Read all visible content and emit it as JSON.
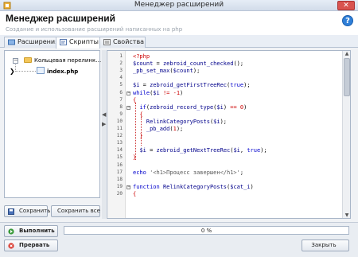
{
  "window": {
    "title": "Менеджер расширений",
    "close": "✕"
  },
  "header": {
    "title": "Менеджер расширений",
    "subtitle": "Создание и использование расширений написанных на php",
    "help": "?"
  },
  "tabs": [
    {
      "label": "Расширения"
    },
    {
      "label": "Скрипты"
    },
    {
      "label": "Свойства"
    }
  ],
  "tree": {
    "folder": "Кольцевая перелинк…",
    "file": "index.php"
  },
  "left_buttons": {
    "save": "Сохранить",
    "save_all": "Сохранить все"
  },
  "code_lines": [
    {
      "n": "1",
      "html": "<span class='ph'>&lt;?php</span>"
    },
    {
      "n": "2",
      "html": "<span class='var'>$count</span> = <span class='fn'>zebroid_count_checked</span>();"
    },
    {
      "n": "3",
      "html": "<span class='fn'>_pb_set_max</span>(<span class='var'>$count</span>);"
    },
    {
      "n": "4",
      "html": ""
    },
    {
      "n": "5",
      "html": "<span class='var'>$i</span> = <span class='fn'>zebroid_getFirstTreeRec</span>(<span class='kw'>true</span>);"
    },
    {
      "n": "6",
      "html": "<span class='kw'>while</span>(<span class='var'>$i</span> <span class='ph'>!=</span> <span class='ph'>-1</span>)"
    },
    {
      "n": "7",
      "html": "<span class='ph'>{</span>"
    },
    {
      "n": "8",
      "html": "  <span class='kw'>if</span>(<span class='fn'>zebroid_record_type</span>(<span class='var'>$i</span>) <span class='ph'>==</span> <span class='ph'>0</span>)"
    },
    {
      "n": "9",
      "html": "  <span class='ph'>{</span>"
    },
    {
      "n": "10",
      "html": "    <span class='fn'>RelinkCategoryPosts</span>(<span class='var'>$i</span>);"
    },
    {
      "n": "11",
      "html": "    <span class='fn'>_pb_add</span>(<span class='ph'>1</span>);"
    },
    {
      "n": "12",
      "html": "  <span class='ph'>}</span>"
    },
    {
      "n": "13",
      "html": ""
    },
    {
      "n": "14",
      "html": "  <span class='var'>$i</span> = <span class='fn'>zebroid_getNextTreeRec</span>(<span class='var'>$i</span>, <span class='kw'>true</span>);"
    },
    {
      "n": "15",
      "html": "<span class='ph'>}</span>"
    },
    {
      "n": "16",
      "html": ""
    },
    {
      "n": "17",
      "html": "<span class='kw'>echo</span> <span class='str'>'&lt;h1&gt;Процесс завершен&lt;/h1&gt;'</span>;"
    },
    {
      "n": "18",
      "html": ""
    },
    {
      "n": "19",
      "html": "<span class='kw'>function</span> <span class='fn'>RelinkCategoryPosts</span>(<span class='var'>$cat_i</span>)"
    },
    {
      "n": "20",
      "html": "<span class='ph'>{</span>"
    }
  ],
  "progress": {
    "value": 0,
    "label": "0 %"
  },
  "footer": {
    "run": "Выполнить",
    "stop": "Прервать",
    "close": "Закрыть"
  },
  "colors": {
    "run_icon": "#3a9a3a",
    "stop_icon": "#d9362b",
    "accent": "#2f7fd8"
  }
}
